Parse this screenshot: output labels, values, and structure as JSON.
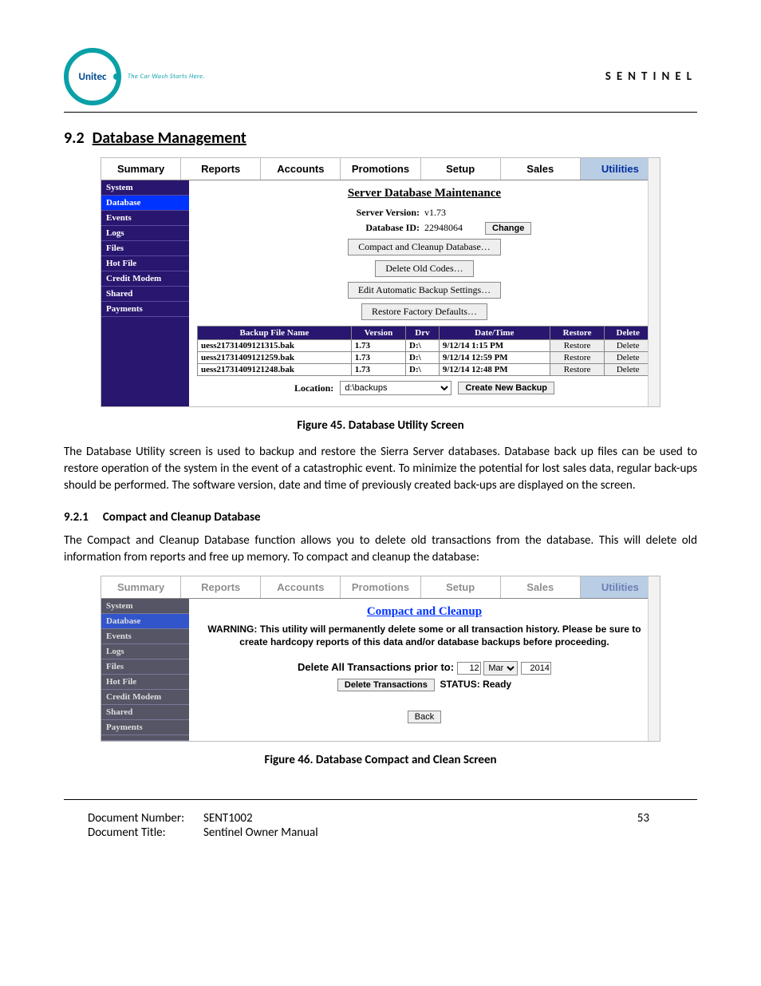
{
  "header": {
    "logo_text": "Unitec",
    "tagline": "The Car Wash Starts Here.",
    "product": "SENTINEL"
  },
  "section": {
    "number": "9.2",
    "title": "Database Management"
  },
  "fig1": {
    "tabs": [
      "Summary",
      "Reports",
      "Accounts",
      "Promotions",
      "Setup",
      "Sales",
      "Utilities"
    ],
    "sidebar": [
      "System",
      "Database",
      "Events",
      "Logs",
      "Files",
      "Hot File",
      "Credit Modem",
      "Shared",
      "Payments"
    ],
    "title": "Server Database Maintenance",
    "server_version_label": "Server Version:",
    "server_version": "v1.73",
    "db_id_label": "Database ID:",
    "db_id": "22948064",
    "change_btn": "Change",
    "btns": [
      "Compact and Cleanup Database…",
      "Delete Old Codes…",
      "Edit Automatic Backup Settings…",
      "Restore Factory Defaults…"
    ],
    "cols": [
      "Backup File Name",
      "Version",
      "Drv",
      "Date/Time",
      "Restore",
      "Delete"
    ],
    "rows": [
      {
        "name": "uess21731409121315.bak",
        "ver": "1.73",
        "drv": "D:\\",
        "dt": "9/12/14 1:15 PM",
        "restore": "Restore",
        "del": "Delete"
      },
      {
        "name": "uess21731409121259.bak",
        "ver": "1.73",
        "drv": "D:\\",
        "dt": "9/12/14 12:59 PM",
        "restore": "Restore",
        "del": "Delete"
      },
      {
        "name": "uess21731409121248.bak",
        "ver": "1.73",
        "drv": "D:\\",
        "dt": "9/12/14 12:48 PM",
        "restore": "Restore",
        "del": "Delete"
      }
    ],
    "location_label": "Location:",
    "location_value": "d:\\backups",
    "create_backup": "Create New Backup",
    "caption": "Figure 45. Database Utility Screen"
  },
  "para1": "The Database Utility screen is used to backup and restore the Sierra Server databases. Database back up files can be used to restore operation of the system in the event of a catastrophic event. To minimize the potential for lost sales data, regular back-ups should be performed. The software version, date and time of previously created back-ups are displayed on the screen.",
  "subsection": {
    "number": "9.2.1",
    "title": "Compact and Cleanup Database"
  },
  "para2": "The Compact and Cleanup Database function allows you to delete old transactions from the database. This will delete old information from reports and free up memory. To compact and cleanup the database:",
  "fig2": {
    "tabs": [
      "Summary",
      "Reports",
      "Accounts",
      "Promotions",
      "Setup",
      "Sales",
      "Utilities"
    ],
    "sidebar": [
      "System",
      "Database",
      "Events",
      "Logs",
      "Files",
      "Hot File",
      "Credit Modem",
      "Shared",
      "Payments"
    ],
    "title": "Compact and Cleanup",
    "warning": "WARNING: This utility will permanently delete some or all transaction history. Please be sure to create hardcopy reports of this data and/or database backups before proceeding.",
    "del_prior_label": "Delete All Transactions prior to:",
    "day": "12",
    "month": "Mar",
    "year": "2014",
    "del_btn": "Delete Transactions",
    "status_label": "STATUS:",
    "status_value": "Ready",
    "back_btn": "Back",
    "caption": "Figure 46. Database Compact and Clean Screen"
  },
  "footer": {
    "docnum_label": "Document Number:",
    "docnum": "SENT1002",
    "title_label": "Document Title:",
    "title": "Sentinel Owner Manual",
    "page": "53"
  }
}
